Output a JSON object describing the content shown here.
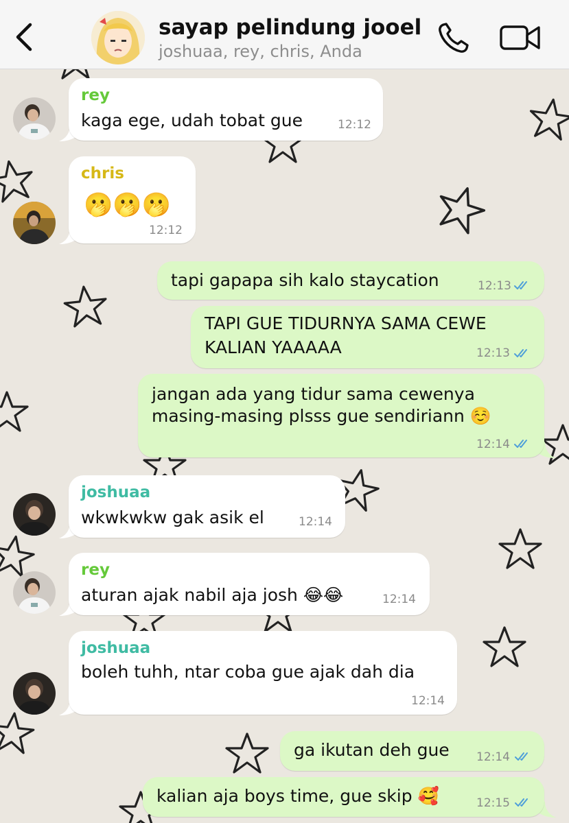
{
  "header": {
    "title": "sayap pelindung jooel",
    "members": "joshuaa, rey, chris, Anda"
  },
  "colors": {
    "rey": "#65c93a",
    "chris": "#d6b817",
    "joshuaa": "#3fbba3",
    "outgoing_bubble": "#dcf8c6",
    "ticks": "#4f9fd9"
  },
  "messages": [
    {
      "sender": "rey",
      "text": "kaga ege, udah tobat gue",
      "time": "12:12"
    },
    {
      "sender": "chris",
      "text": "🫢🫢🫢",
      "time": "12:12"
    },
    {
      "text": "tapi gapapa sih kalo staycation",
      "time": "12:13"
    },
    {
      "line1": "TAPI GUE TIDURNYA SAMA CEWE",
      "line2": "KALIAN YAAAAA",
      "time": "12:13"
    },
    {
      "line1": "jangan ada yang tidur sama cewenya",
      "line2": "masing-masing plsss gue sendiriann ☺️",
      "time": "12:14"
    },
    {
      "sender": "joshuaa",
      "text": "wkwkwkw gak asik el",
      "time": "12:14"
    },
    {
      "sender": "rey",
      "text": "aturan ajak nabil aja josh 😂😂",
      "time": "12:14"
    },
    {
      "sender": "joshuaa",
      "text": "boleh tuhh, ntar coba gue ajak dah dia",
      "time": "12:14"
    },
    {
      "text": "ga ikutan deh gue",
      "time": "12:14"
    },
    {
      "text": "kalian aja boys time, gue skip 🥰",
      "time": "12:15"
    }
  ]
}
